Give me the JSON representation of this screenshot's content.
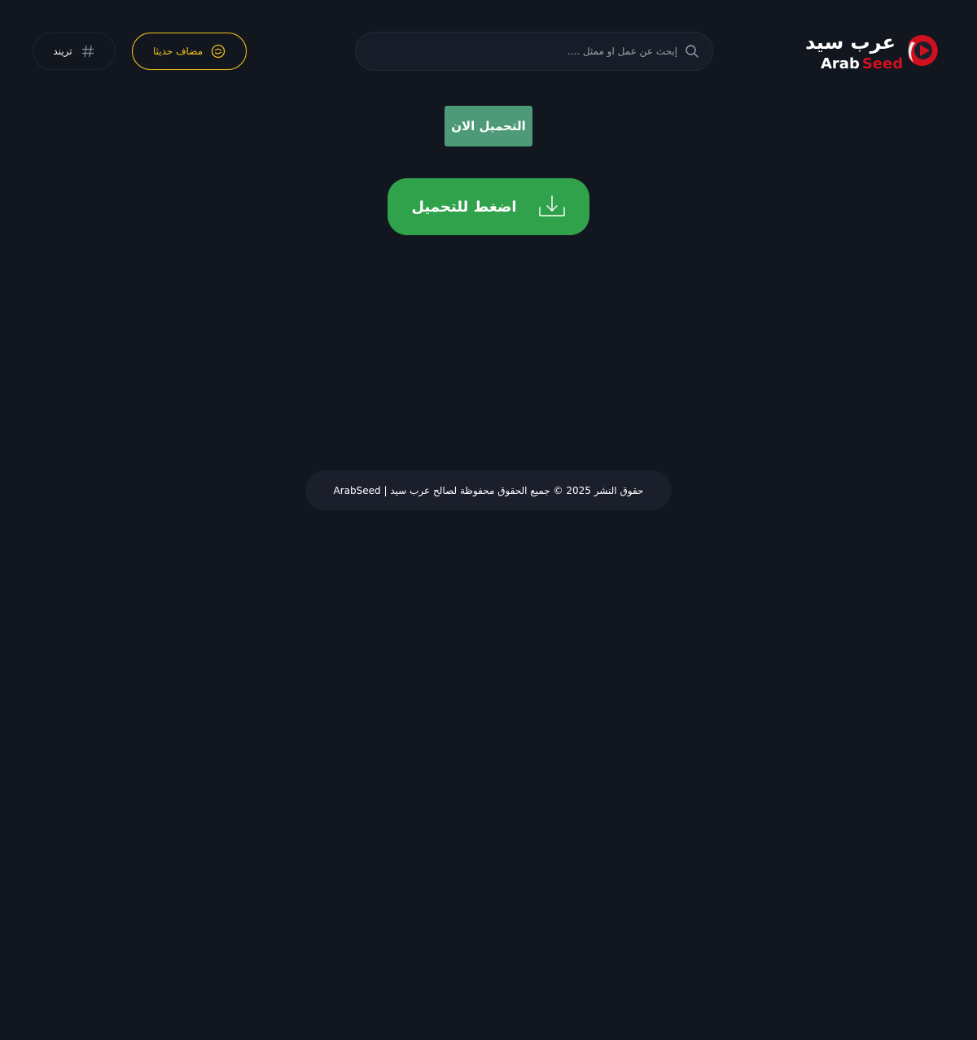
{
  "logo": {
    "arabic": "عرب سيد",
    "latin_part1": "Arab",
    "latin_part2": "Seed"
  },
  "search": {
    "placeholder": "إبحث عن عمل او ممثل ....",
    "icon": "search-icon"
  },
  "nav": {
    "new_label": "مضاف حديثا",
    "new_icon": "clock-icon",
    "trend_label": "تريند",
    "trend_icon": "hashtag-icon"
  },
  "download": {
    "now_label": "التحميل الان",
    "click_label": "اضغط للتحميل",
    "click_icon": "download-icon"
  },
  "footer": {
    "copyright": "حقوق النشر 2025 © جميع الحقوق محفوظة لصالح عرب سيد | ArabSeed"
  },
  "colors": {
    "background": "#12161f",
    "accent_yellow": "#f1c21b",
    "brand_red": "#d0101f",
    "download_now_bg": "#4d9a78",
    "download_click_bg": "#31a24c"
  }
}
